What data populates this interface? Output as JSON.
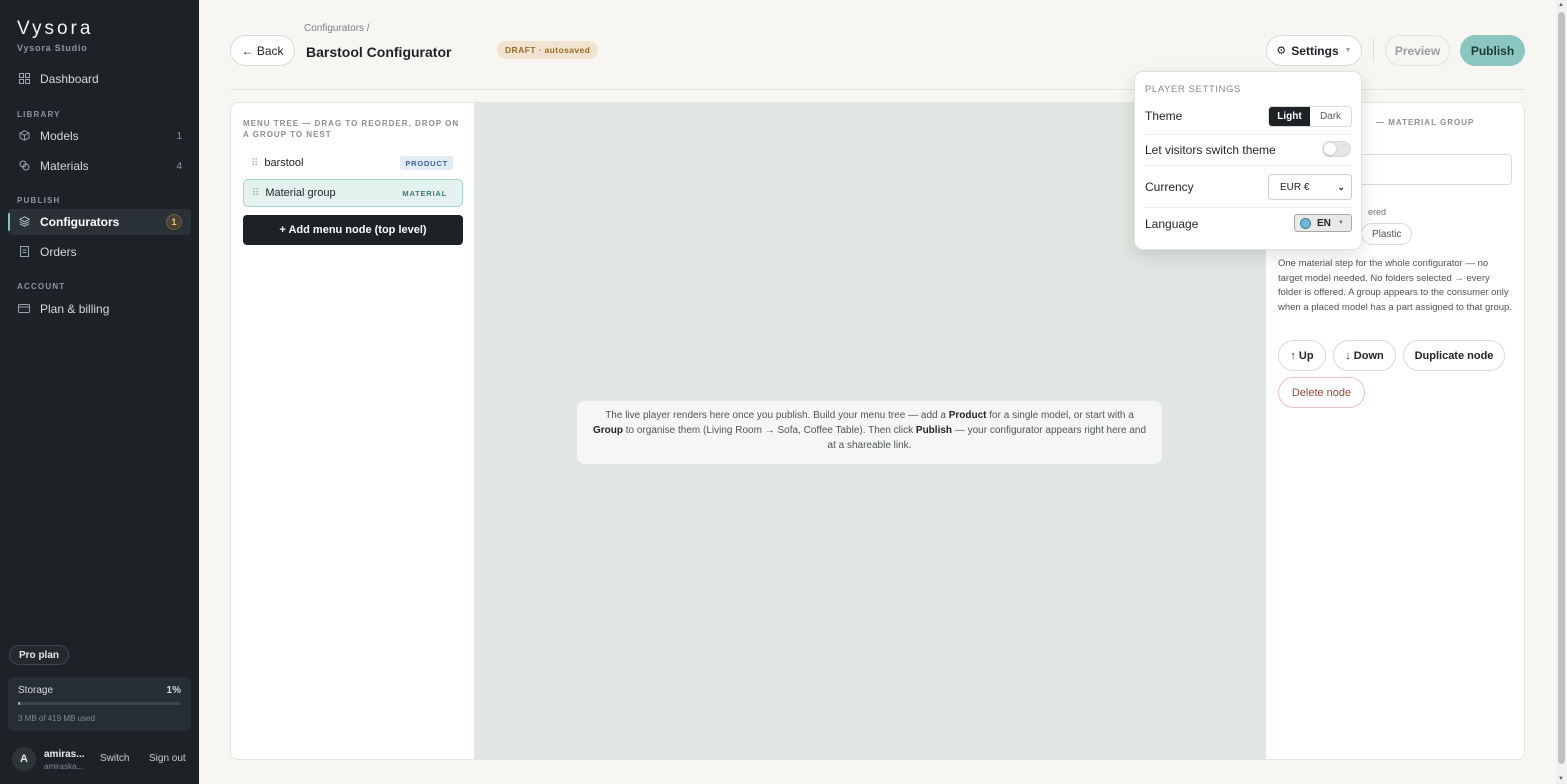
{
  "sidebar": {
    "brand": "Vysora",
    "brand_sub": "Vysora Studio",
    "dashboard": "Dashboard",
    "library_label": "LIBRARY",
    "models": "Models",
    "models_count": "1",
    "materials": "Materials",
    "materials_count": "4",
    "publish_label": "PUBLISH",
    "configurators": "Configurators",
    "configurators_count": "1",
    "orders": "Orders",
    "account_label": "ACCOUNT",
    "plan_billing": "Plan & billing",
    "plan_pill": "Pro plan",
    "storage_label": "Storage",
    "storage_pct": "1%",
    "storage_fraction": 0.01,
    "storage_detail": "3 MB of 419 MB used",
    "user_initial": "A",
    "user_name": "amiras...",
    "user_email": "amiraska...",
    "switch": "Switch",
    "sign_out": "Sign out"
  },
  "header": {
    "breadcrumb": "Configurators   /",
    "back": "← Back",
    "title": "Barstool Configurator",
    "draft_badge": "DRAFT · autosaved",
    "settings": "Settings",
    "preview": "Preview",
    "publish": "Publish"
  },
  "tree": {
    "heading": "MENU TREE — DRAG TO REORDER, DROP ON A GROUP TO NEST",
    "grip": "⠿",
    "nodes": [
      {
        "label": "barstool",
        "tag": "PRODUCT"
      },
      {
        "label": "Material group",
        "tag": "MATERIAL"
      }
    ],
    "add_button": "+ Add menu node (top level)"
  },
  "preview_note": {
    "t1": "The live player renders here once you publish. Build your menu tree — add a ",
    "b1": "Product",
    "t2": " for a single model, or start with a ",
    "b2": "Group",
    "t3": " to organise them (Living Room → Sofa, Coffee Table). Then click ",
    "b3": "Publish",
    "t4": " — your configurator appears right here and at a shareable link."
  },
  "props": {
    "heading": "— MATERIAL GROUP",
    "partial_label": "ered",
    "chip_plastic": "Plastic",
    "description": "One material step for the whole configurator — no target model needed. No folders selected → every folder is offered. A group appears to the consumer only when a placed model has a part assigned to that group.",
    "up": "↑ Up",
    "down": "↓ Down",
    "duplicate": "Duplicate node",
    "delete": "Delete node"
  },
  "popover": {
    "title": "PLAYER SETTINGS",
    "theme_label": "Theme",
    "theme_light": "Light",
    "theme_dark": "Dark",
    "visitors_label": "Let visitors switch theme",
    "currency_label": "Currency",
    "currency_value": "EUR €",
    "language_label": "Language",
    "language_value": "EN"
  },
  "colors": {
    "sidebar_bg": "#1c2226",
    "accent": "#8cc6c1",
    "draft_bg": "#f1e3cf",
    "danger": "#a0453c"
  },
  "icons": {
    "dashboard": "grid-icon",
    "models": "cube-icon",
    "materials": "swatch-icon",
    "configurators": "layers-icon",
    "orders": "receipt-icon",
    "plan": "card-icon",
    "settings": "gear-icon",
    "language": "globe-icon"
  }
}
